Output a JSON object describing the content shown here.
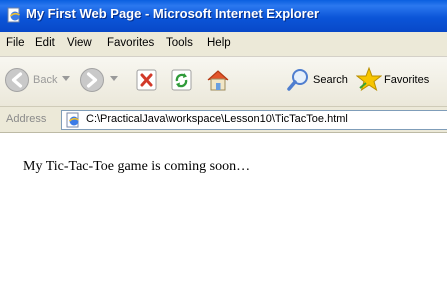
{
  "window": {
    "title": "My First Web Page - Microsoft Internet Explorer"
  },
  "menubar": {
    "items": [
      "File",
      "Edit",
      "View",
      "Favorites",
      "Tools",
      "Help"
    ]
  },
  "toolbar": {
    "back_label": "Back",
    "search_label": "Search",
    "favorites_label": "Favorites",
    "icons": [
      "back-icon",
      "forward-icon",
      "stop-icon",
      "refresh-icon",
      "home-icon",
      "search-icon",
      "favorites-star-icon"
    ]
  },
  "address": {
    "label": "Address",
    "url": "C:\\PracticalJava\\workspace\\Lesson10\\TicTacToe.html"
  },
  "page": {
    "body_text": "My Tic-Tac-Toe game is coming soon…"
  },
  "colors": {
    "titlebar": "#0a5fe0",
    "chrome": "#ece9d8",
    "back_arrow": "#3aa236",
    "stop": "#d23a2a",
    "refresh": "#2f9a3a",
    "star": "#f7c500"
  }
}
